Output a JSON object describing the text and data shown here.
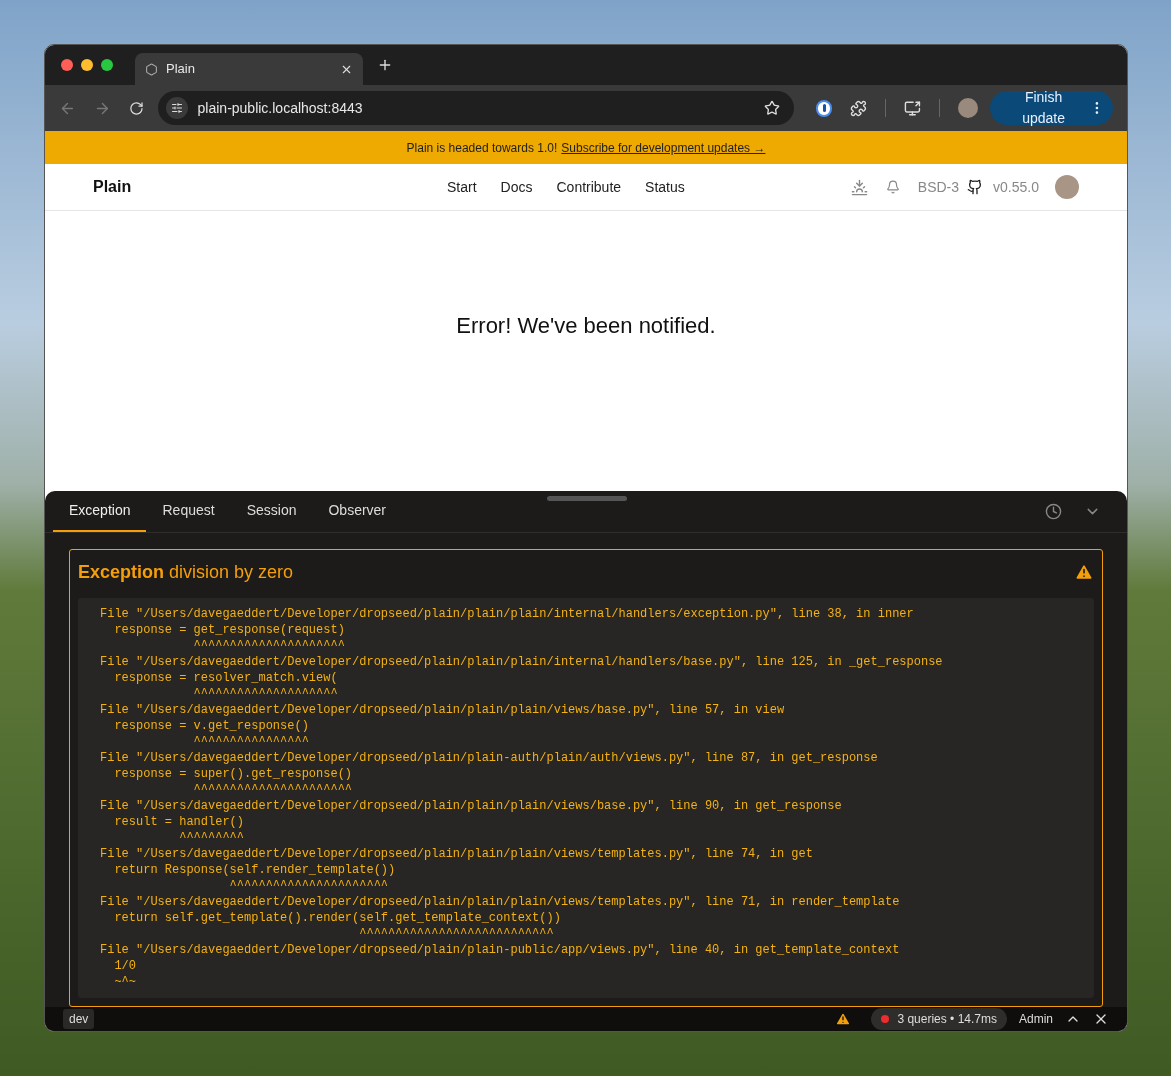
{
  "browser": {
    "tab_title": "Plain",
    "address": "plain-public.localhost:8443",
    "update_button": "Finish update"
  },
  "banner": {
    "text": "Plain is headed towards 1.0!",
    "link": "Subscribe for development updates →"
  },
  "site_nav": {
    "logo": "Plain",
    "links": [
      "Start",
      "Docs",
      "Contribute",
      "Status"
    ],
    "license": "BSD-3",
    "version": "v0.55.0"
  },
  "page": {
    "message": "Error! We've been notified."
  },
  "toolbar": {
    "tabs": [
      {
        "label": "Exception",
        "selected": true
      },
      {
        "label": "Request",
        "selected": false
      },
      {
        "label": "Session",
        "selected": false
      },
      {
        "label": "Observer",
        "selected": false
      }
    ],
    "exception": {
      "type": "Exception",
      "message": "division by zero"
    },
    "frames": [
      {
        "location": "File \"/Users/davegaeddert/Developer/dropseed/plain/plain/plain/internal/handlers/exception.py\", line 38, in inner",
        "code": "  response = get_response(request)",
        "marker": "             ^^^^^^^^^^^^^^^^^^^^^"
      },
      {
        "location": "File \"/Users/davegaeddert/Developer/dropseed/plain/plain/plain/internal/handlers/base.py\", line 125, in _get_response",
        "code": "  response = resolver_match.view(",
        "marker": "             ^^^^^^^^^^^^^^^^^^^^"
      },
      {
        "location": "File \"/Users/davegaeddert/Developer/dropseed/plain/plain/plain/views/base.py\", line 57, in view",
        "code": "  response = v.get_response()",
        "marker": "             ^^^^^^^^^^^^^^^^"
      },
      {
        "location": "File \"/Users/davegaeddert/Developer/dropseed/plain/plain-auth/plain/auth/views.py\", line 87, in get_response",
        "code": "  response = super().get_response()",
        "marker": "             ^^^^^^^^^^^^^^^^^^^^^^"
      },
      {
        "location": "File \"/Users/davegaeddert/Developer/dropseed/plain/plain/plain/views/base.py\", line 90, in get_response",
        "code": "  result = handler()",
        "marker": "           ^^^^^^^^^"
      },
      {
        "location": "File \"/Users/davegaeddert/Developer/dropseed/plain/plain/plain/views/templates.py\", line 74, in get",
        "code": "  return Response(self.render_template())",
        "marker": "                  ^^^^^^^^^^^^^^^^^^^^^^"
      },
      {
        "location": "File \"/Users/davegaeddert/Developer/dropseed/plain/plain/plain/views/templates.py\", line 71, in render_template",
        "code": "  return self.get_template().render(self.get_template_context())",
        "marker": "                                    ^^^^^^^^^^^^^^^^^^^^^^^^^^^"
      },
      {
        "location": "File \"/Users/davegaeddert/Developer/dropseed/plain/plain-public/app/views.py\", line 40, in get_template_context",
        "code": "  1/0",
        "marker": "  ~^~"
      }
    ]
  },
  "bottom_bar": {
    "env": "dev",
    "queries": "3 queries • 14.7ms",
    "user": "Admin"
  }
}
